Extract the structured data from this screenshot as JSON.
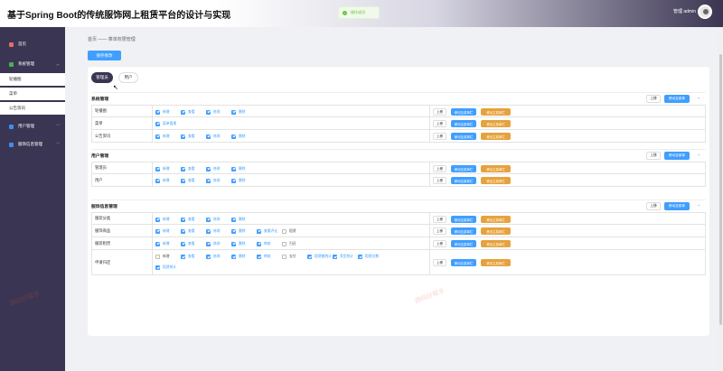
{
  "header": {
    "title": "基于Spring Boot的传统服饰网上租赁平台的设计与实现",
    "user_label": "管理 admin"
  },
  "toast": {
    "text": "操作成功"
  },
  "sidebar": {
    "items": [
      {
        "label": "首页",
        "icon": "home-icon",
        "color": "#e86a6a"
      },
      {
        "label": "系统管理",
        "icon": "system-icon",
        "color": "#4caf50"
      },
      {
        "label": "轮播图"
      },
      {
        "label": "菜单"
      },
      {
        "label": "公告资讯"
      },
      {
        "label": "用户管理",
        "icon": "user-icon",
        "color": "#3d8ef0"
      },
      {
        "label": "服饰信息管理",
        "icon": "clothing-icon",
        "color": "#3d8ef0"
      }
    ]
  },
  "breadcrumb": {
    "home": "首页",
    "current": "菜单权限管理",
    "sep": "——"
  },
  "save_button": "保存修改",
  "tabs": [
    "管理员",
    "用户"
  ],
  "row_buttons": {
    "up": "上移",
    "move": "移动至菜单栏",
    "remove": "移出主菜单栏"
  },
  "section_buttons": {
    "up": "上移",
    "move": "移动至菜单"
  },
  "sections": [
    {
      "title": "系统管理",
      "rows": [
        {
          "name": "轮播图",
          "perms": [
            {
              "label": "新增",
              "on": true
            },
            {
              "label": "查看",
              "on": true
            },
            {
              "label": "修改",
              "on": true
            },
            {
              "label": "删除",
              "on": true
            }
          ]
        },
        {
          "name": "菜单",
          "perms": [
            {
              "label": "菜单管理",
              "on": true
            }
          ]
        },
        {
          "name": "公告资讯",
          "perms": [
            {
              "label": "新增",
              "on": true
            },
            {
              "label": "查看",
              "on": true
            },
            {
              "label": "修改",
              "on": true
            },
            {
              "label": "删除",
              "on": true
            }
          ]
        }
      ]
    },
    {
      "title": "用户管理",
      "rows": [
        {
          "name": "管理员",
          "perms": [
            {
              "label": "新增",
              "on": true
            },
            {
              "label": "查看",
              "on": true
            },
            {
              "label": "修改",
              "on": true
            },
            {
              "label": "删除",
              "on": true
            }
          ]
        },
        {
          "name": "用户",
          "perms": [
            {
              "label": "新增",
              "on": true
            },
            {
              "label": "查看",
              "on": true
            },
            {
              "label": "修改",
              "on": true
            },
            {
              "label": "删除",
              "on": true
            }
          ]
        }
      ]
    },
    {
      "title": "服饰信息管理",
      "rows": [
        {
          "name": "服装分类",
          "perms": [
            {
              "label": "新增",
              "on": true
            },
            {
              "label": "查看",
              "on": true
            },
            {
              "label": "修改",
              "on": true
            },
            {
              "label": "删除",
              "on": true
            }
          ]
        },
        {
          "name": "服饰商品",
          "perms": [
            {
              "label": "新增",
              "on": true
            },
            {
              "label": "查看",
              "on": true
            },
            {
              "label": "修改",
              "on": true
            },
            {
              "label": "删除",
              "on": true
            },
            {
              "label": "查看评论",
              "on": true
            },
            {
              "label": "租赁",
              "on": false
            }
          ]
        },
        {
          "name": "服装租赁",
          "perms": [
            {
              "label": "新增",
              "on": true
            },
            {
              "label": "查看",
              "on": true
            },
            {
              "label": "修改",
              "on": true
            },
            {
              "label": "删除",
              "on": true
            },
            {
              "label": "审核",
              "on": true
            },
            {
              "label": "归还",
              "on": false
            }
          ]
        },
        {
          "name": "申请归还",
          "perms": [
            {
              "label": "新增",
              "on": false
            },
            {
              "label": "查看",
              "on": true
            },
            {
              "label": "修改",
              "on": true
            },
            {
              "label": "删除",
              "on": true
            },
            {
              "label": "审核",
              "on": true
            },
            {
              "label": "支付",
              "on": false
            },
            {
              "label": "租赁额统计",
              "on": true
            },
            {
              "label": "类型统计",
              "on": true
            },
            {
              "label": "租赁总数",
              "on": true
            },
            {
              "label": "租赁统计",
              "on": true
            }
          ]
        }
      ]
    }
  ],
  "watermark": "源码好帮手"
}
